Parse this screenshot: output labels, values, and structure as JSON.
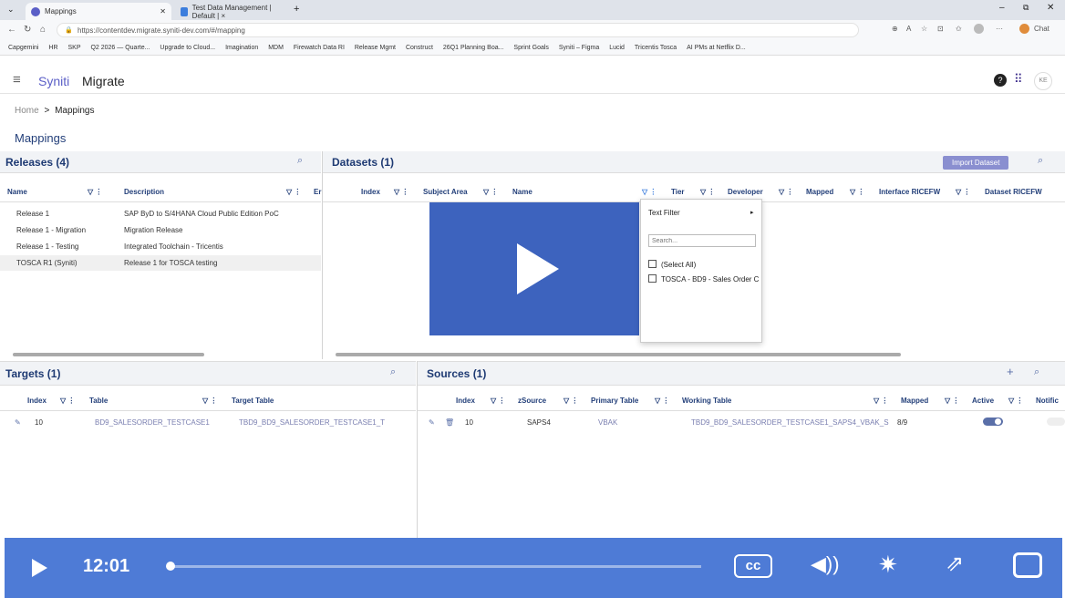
{
  "browser": {
    "tabs": [
      {
        "label": "Mappings",
        "active": true
      },
      {
        "label": "Test Data Management | Default | ×",
        "active": false
      }
    ],
    "url": "https://contentdev.migrate.syniti-dev.com/#/mapping",
    "bookmarks": [
      "Capgemini",
      "HR",
      "SKP",
      "Q2 2026 — Quarte...",
      "Upgrade to Cloud...",
      "Imagination",
      "MDM",
      "Firewatch Data RI",
      "Release Mgmt",
      "Construct",
      "26Q1 Planning Boa...",
      "Sprint Goals",
      "Syniti – Figma",
      "Lucid",
      "Tricentis Tosca",
      "AI PMs at Netflix D..."
    ],
    "chat_label": "Chat"
  },
  "app": {
    "brand": "Syniti",
    "product": "Migrate",
    "user_initials": "KE",
    "breadcrumb": {
      "home": "Home",
      "sep": ">",
      "current": "Mappings"
    },
    "page_title": "Mappings"
  },
  "releases": {
    "title": "Releases (4)",
    "columns": [
      "Name",
      "Description",
      "Er"
    ],
    "rows": [
      {
        "name": "Release 1",
        "description": "SAP ByD to S/4HANA Cloud Public Edition PoC"
      },
      {
        "name": "Release 1 - Migration",
        "description": "Migration Release"
      },
      {
        "name": "Release 1 - Testing",
        "description": "Integrated Toolchain - Tricentis"
      },
      {
        "name": "TOSCA R1 (Syniti)",
        "description": "Release 1 for TOSCA testing"
      }
    ]
  },
  "datasets": {
    "title": "Datasets (1)",
    "import_label": "Import Dataset",
    "columns": [
      "Index",
      "Subject Area",
      "Name",
      "Tier",
      "Developer",
      "Mapped",
      "Interface RICEFW",
      "Dataset RICEFW"
    ],
    "filter": {
      "type": "Text Filter",
      "search_placeholder": "Search...",
      "options": [
        "(Select All)",
        "TOSCA - BD9 - Sales Order C"
      ]
    }
  },
  "targets": {
    "title": "Targets (1)",
    "columns": [
      "Index",
      "Table",
      "Target Table"
    ],
    "rows": [
      {
        "index": "10",
        "table": "BD9_SALESORDER_TESTCASE1",
        "target": "TBD9_BD9_SALESORDER_TESTCASE1_T"
      }
    ]
  },
  "sources": {
    "title": "Sources (1)",
    "columns": [
      "Index",
      "zSource",
      "Primary Table",
      "Working Table",
      "Mapped",
      "Active",
      "Notific"
    ],
    "rows": [
      {
        "index": "10",
        "zsource": "SAPS4",
        "primary": "VBAK",
        "working": "TBD9_BD9_SALESORDER_TESTCASE1_SAPS4_VBAK_S",
        "mapped": "8/9"
      }
    ]
  },
  "video": {
    "time": "12:01",
    "progress": 0.0,
    "cc": "cc"
  },
  "colors": {
    "accent": "#4e7bd6",
    "brand": "#5b5fc7",
    "play_overlay": "#3d63be"
  }
}
